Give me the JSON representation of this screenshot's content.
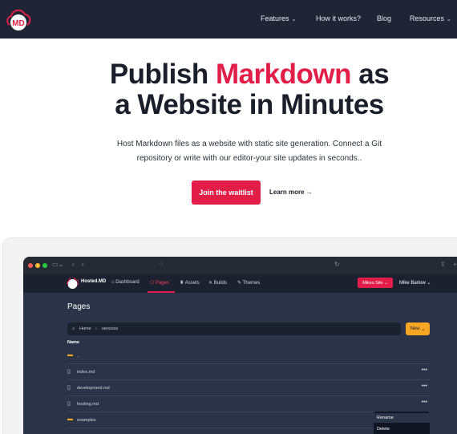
{
  "nav": {
    "logo_text": "MD",
    "items": [
      {
        "label": "Features",
        "has_chevron": true
      },
      {
        "label": "How it works?",
        "has_chevron": false
      },
      {
        "label": "Blog",
        "has_chevron": false
      },
      {
        "label": "Resources",
        "has_chevron": true
      }
    ]
  },
  "hero": {
    "title_line1_pre": "Publish ",
    "title_line1_accent": "Markdown",
    "title_line1_post": " as",
    "title_line2": "a Website in Minutes",
    "subtitle": "Host Markdown files as a website with static site generation. Connect a Git repository or write with our editor-your site updates in seconds..",
    "cta": "Join the waitlist",
    "learn_more": "Learn more →"
  },
  "app": {
    "brand": "Hosted.MD",
    "nav": [
      "Dashboard",
      "Pages",
      "Assets",
      "Builds",
      "Themes"
    ],
    "active_nav": "Pages",
    "site_selector": "Mikes Site",
    "user": "Mike Barlow",
    "page_title": "Pages",
    "breadcrumb": [
      "Home",
      "services"
    ],
    "new_button": "New",
    "column_name": "Name",
    "rows": [
      {
        "type": "folder",
        "name": "..",
        "more": ""
      },
      {
        "type": "file",
        "name": "index.md",
        "more": "•••"
      },
      {
        "type": "file",
        "name": "development.md",
        "more": "•••"
      },
      {
        "type": "file",
        "name": "hosting.md",
        "more": "•••"
      },
      {
        "type": "folder",
        "name": "examples",
        "more": ""
      }
    ],
    "context_menu": [
      "Rename",
      "Delete"
    ]
  },
  "colors": {
    "accent": "#e11d48",
    "nav_bg": "#1f2534",
    "app_bg": "#2a3347",
    "folder": "#f5a623"
  }
}
